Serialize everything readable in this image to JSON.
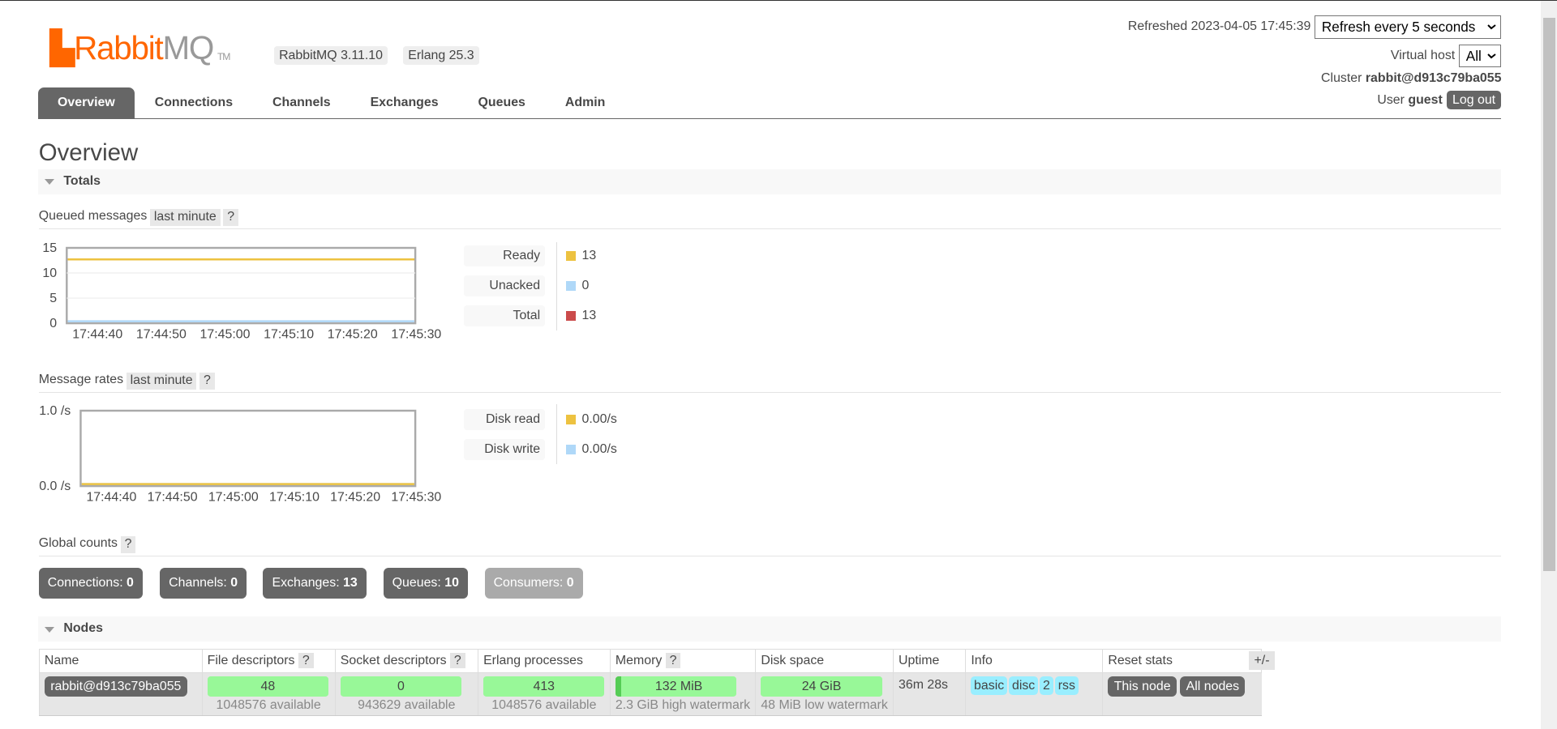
{
  "header": {
    "logo": "RabbitMQ",
    "logo_rabbit": "Rabbit",
    "logo_mq": "MQ",
    "logo_tm": "TM",
    "version": "RabbitMQ 3.11.10",
    "erlang": "Erlang 25.3",
    "refreshed_label": "Refreshed 2023-04-05 17:45:39",
    "refresh_select": "Refresh every 5 seconds",
    "vhost_label": "Virtual host",
    "vhost_select": "All",
    "cluster_label": "Cluster",
    "cluster_name": "rabbit@d913c79ba055",
    "user_label": "User",
    "user_name": "guest",
    "logout": "Log out"
  },
  "tabs": [
    "Overview",
    "Connections",
    "Channels",
    "Exchanges",
    "Queues",
    "Admin"
  ],
  "page_title": "Overview",
  "totals": {
    "title": "Totals",
    "queued": {
      "label": "Queued messages",
      "range": "last minute",
      "help": "?",
      "yticks": [
        "15",
        "10",
        "5",
        "0"
      ],
      "xticks": [
        "17:44:40",
        "17:44:50",
        "17:45:00",
        "17:45:10",
        "17:45:20",
        "17:45:30"
      ],
      "ymax": 15,
      "series": [
        {
          "name": "Ready",
          "value": "13",
          "color": "#edc240",
          "level": 13
        },
        {
          "name": "Unacked",
          "value": "0",
          "color": "#afd8f8",
          "level": 0
        },
        {
          "name": "Total",
          "value": "13",
          "color": "#cb4b4b",
          "level": 13
        }
      ]
    },
    "rates": {
      "label": "Message rates",
      "range": "last minute",
      "help": "?",
      "yticks": [
        "1.0 /s",
        "0.0 /s"
      ],
      "xticks": [
        "17:44:40",
        "17:44:50",
        "17:45:00",
        "17:45:10",
        "17:45:20",
        "17:45:30"
      ],
      "ymax": 1,
      "series": [
        {
          "name": "Disk read",
          "value": "0.00/s",
          "color": "#edc240",
          "level": 0
        },
        {
          "name": "Disk write",
          "value": "0.00/s",
          "color": "#afd8f8",
          "level": 0
        }
      ]
    },
    "global": {
      "label": "Global counts",
      "help": "?",
      "counts": [
        {
          "label": "Connections:",
          "value": "0"
        },
        {
          "label": "Channels:",
          "value": "0"
        },
        {
          "label": "Exchanges:",
          "value": "13"
        },
        {
          "label": "Queues:",
          "value": "10"
        },
        {
          "label": "Consumers:",
          "value": "0"
        }
      ]
    }
  },
  "nodes": {
    "title": "Nodes",
    "plusminus": "+/-",
    "headers": [
      "Name",
      "File descriptors",
      "Socket descriptors",
      "Erlang processes",
      "Memory",
      "Disk space",
      "Uptime",
      "Info",
      "Reset stats"
    ],
    "help": "?",
    "row": {
      "name": "rabbit@d913c79ba055",
      "fd": "48",
      "fd_avail": "1048576 available",
      "sock": "0",
      "sock_avail": "943629 available",
      "proc": "413",
      "proc_avail": "1048576 available",
      "mem": "132 MiB",
      "mem_sub": "2.3 GiB high watermark",
      "disk": "24 GiB",
      "disk_sub": "48 MiB low watermark",
      "uptime": "36m 28s",
      "info": [
        "basic",
        "disc",
        "2",
        "rss"
      ],
      "reset_this": "This node",
      "reset_all": "All nodes"
    }
  }
}
